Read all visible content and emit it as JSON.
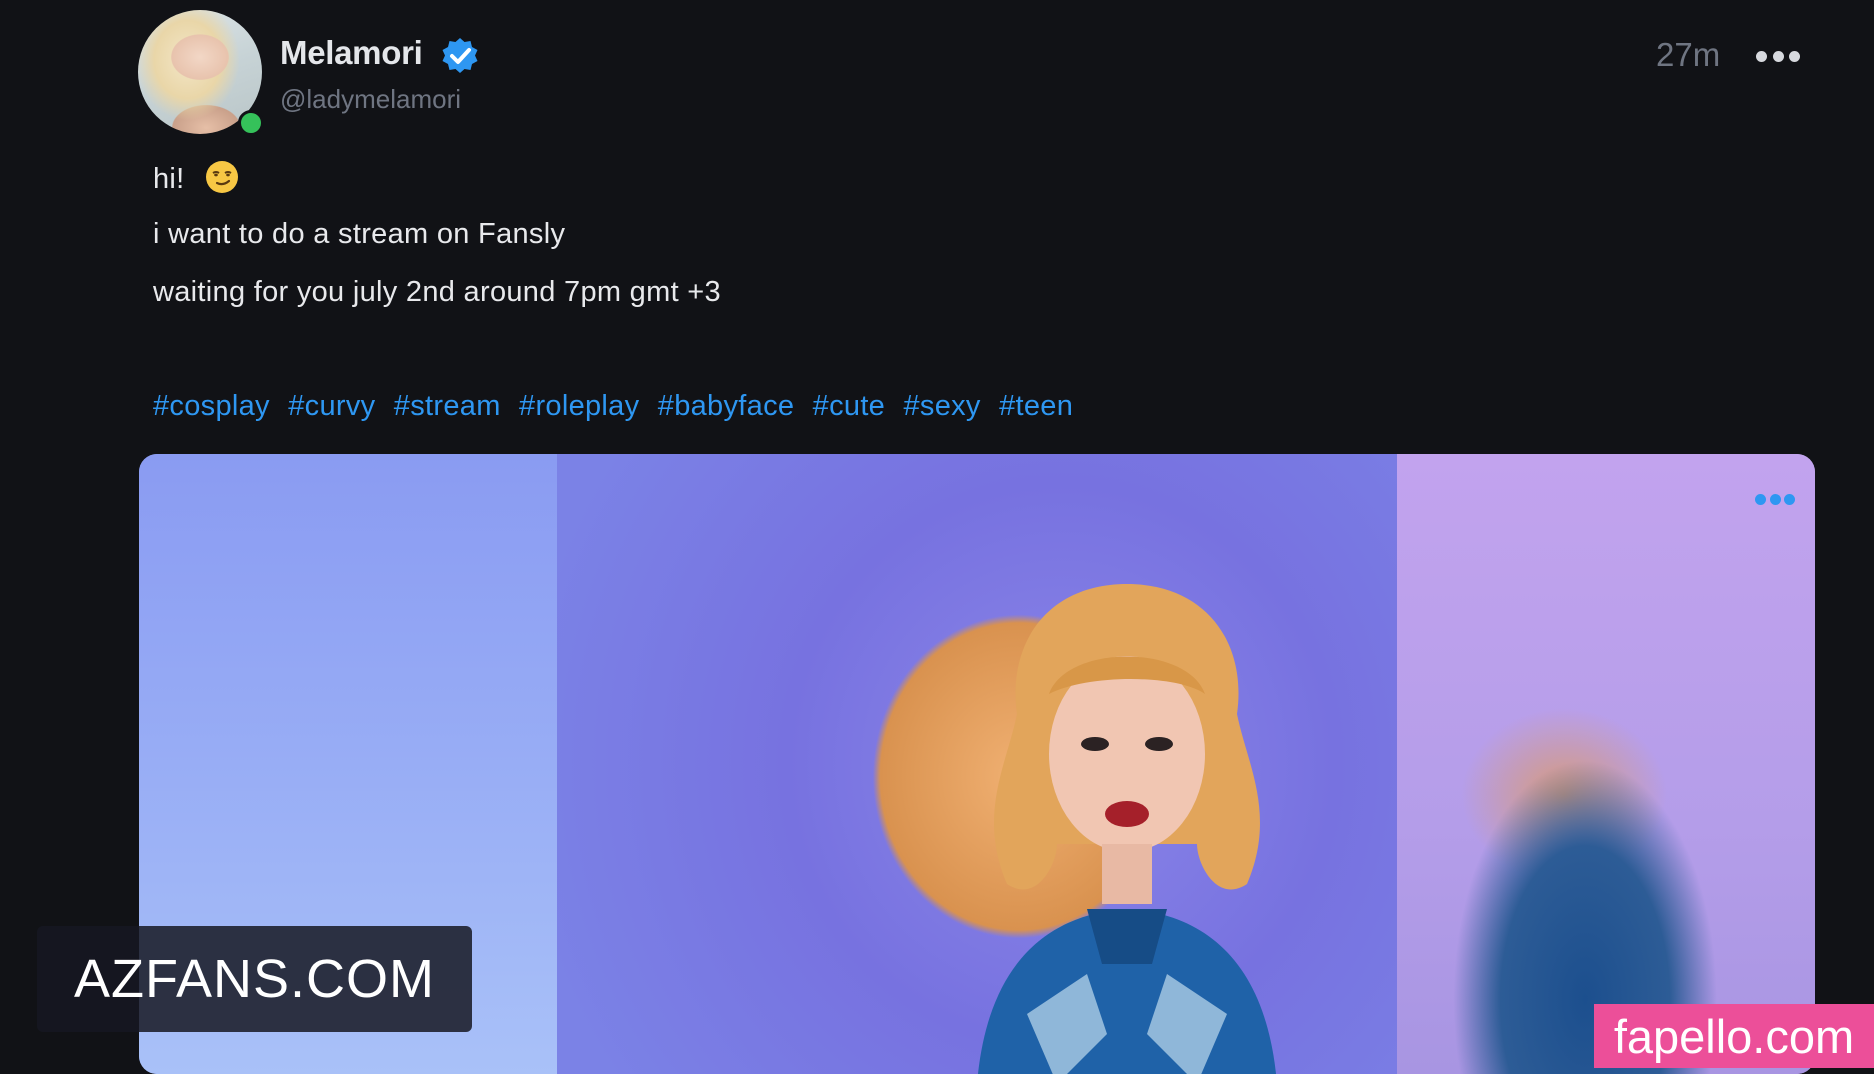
{
  "author": {
    "display_name": "Melamori",
    "username": "@ladymelamori",
    "verified": true,
    "online": true
  },
  "post": {
    "timestamp": "27m",
    "lines": [
      "hi!",
      "i want to do a stream on Fansly",
      "waiting for you july 2nd around 7pm gmt +3"
    ],
    "emoji": "smirk-face",
    "tags": [
      "#cosplay",
      "#curvy",
      "#stream",
      "#roleplay",
      "#babyface",
      "#cute",
      "#sexy",
      "#teen"
    ]
  },
  "watermarks": {
    "left": "AZFANS.COM",
    "right": "fapello.com"
  },
  "colors": {
    "background": "#111216",
    "link": "#2e97f2",
    "verified": "#2e97f2",
    "online": "#35c15a",
    "muted": "#6f7582"
  }
}
